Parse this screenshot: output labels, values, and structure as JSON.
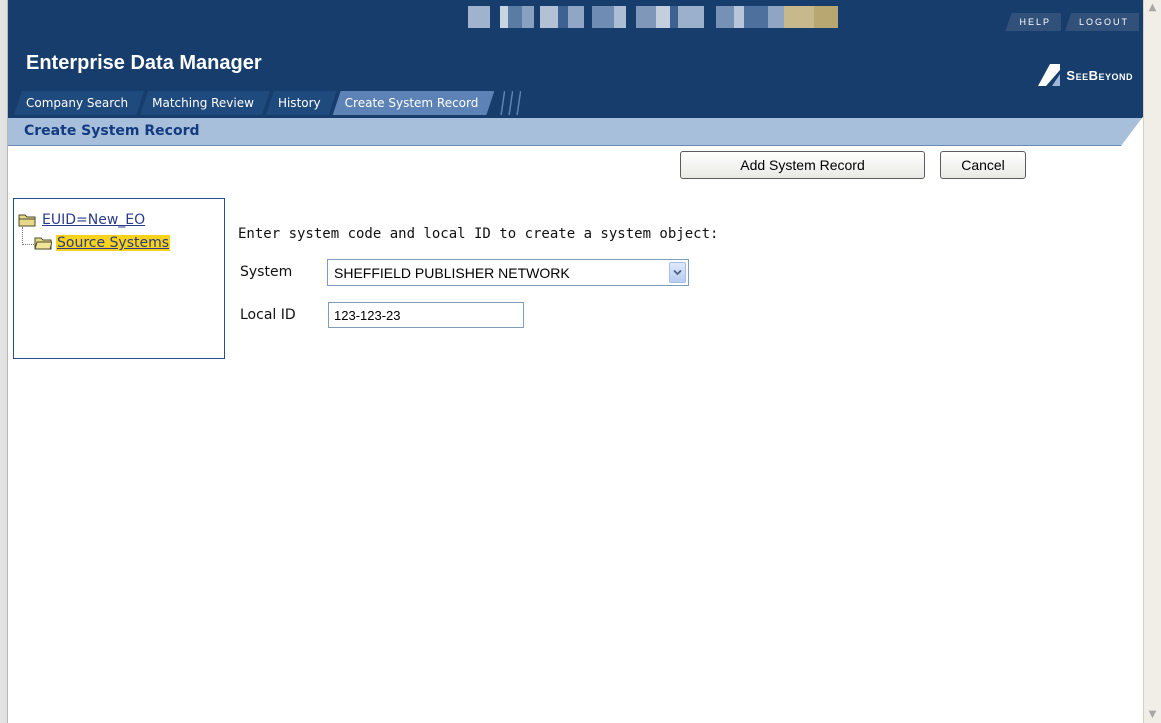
{
  "app": {
    "title": "Enterprise Data Manager",
    "logo_text": "SeeBeyond"
  },
  "top_links": {
    "help": "HELP",
    "logout": "LOGOUT"
  },
  "tabs": [
    {
      "label": "Company Search",
      "active": false
    },
    {
      "label": "Matching Review",
      "active": false
    },
    {
      "label": "History",
      "active": false
    },
    {
      "label": "Create System Record",
      "active": true
    }
  ],
  "page": {
    "title": "Create System Record"
  },
  "actions": {
    "add_label": "Add System Record",
    "cancel_label": "Cancel"
  },
  "tree": {
    "root": "EUID=New_EO",
    "child": "Source Systems",
    "child_selected": true
  },
  "form": {
    "intro": "Enter system code and local ID to create a system object:",
    "system_label": "System",
    "system_value": "SHEFFIELD PUBLISHER NETWORK",
    "local_id_label": "Local ID",
    "local_id_value": "123-123-23"
  },
  "icons": {
    "folder": "folder-icon",
    "dropdown": "chevron-down-icon",
    "logo": "seebeyond-logo-icon",
    "scroll_up": "scroll-up-arrow-icon",
    "scroll_down": "scroll-down-arrow-icon"
  },
  "colors": {
    "header_bg": "#163d6c",
    "active_tab": "#5d83b6",
    "subheader_bg": "#a8bfdb",
    "tree_highlight": "#f9d21b",
    "link": "#2a3b8c"
  }
}
